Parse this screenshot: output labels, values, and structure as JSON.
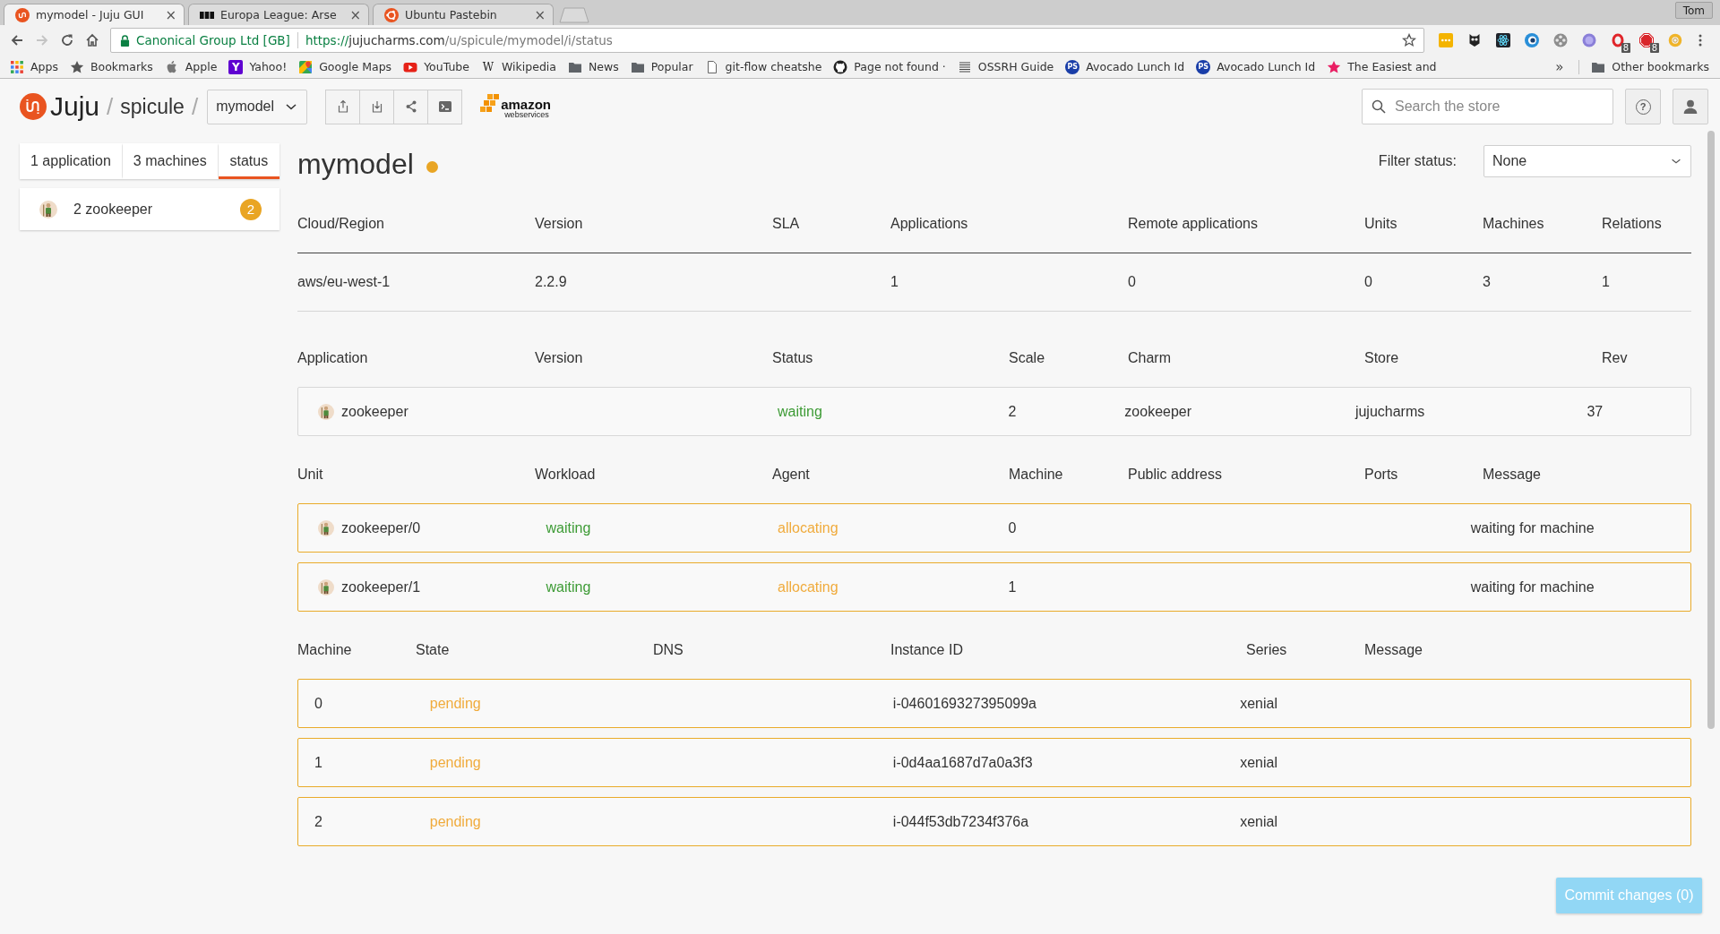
{
  "browser": {
    "tabs": [
      {
        "title": "mymodel - Juju GUI",
        "selected": true,
        "close": "×"
      },
      {
        "title": "Europa League: Arse",
        "selected": false,
        "close": "×"
      },
      {
        "title": "Ubuntu Pastebin",
        "selected": false,
        "close": "×"
      }
    ],
    "profile": "Tom",
    "nav_buttons": [
      {
        "disabled": false
      },
      {
        "disabled": true
      },
      {
        "disabled": false
      },
      {
        "disabled": false
      }
    ],
    "address": {
      "identity": "Canonical Group Ltd [GB]",
      "scheme": "https://",
      "host": "jujucharms.com",
      "path": "/u/spicule/mymodel/i/status"
    },
    "extensions": [
      {
        "kind": "dots"
      },
      {
        "kind": "owl"
      },
      {
        "kind": "atom"
      },
      {
        "kind": "eye"
      },
      {
        "kind": "reel"
      },
      {
        "kind": "ws"
      },
      {
        "kind": "opera",
        "badge": "8"
      },
      {
        "kind": "stop",
        "badge": "8"
      },
      {
        "kind": "donut"
      }
    ],
    "bookmarks": [
      {
        "kind": "apps",
        "label": "Apps"
      },
      {
        "kind": "star",
        "label": "Bookmarks"
      },
      {
        "kind": "apple",
        "label": "Apple"
      },
      {
        "kind": "yahoo",
        "glyph": "Y",
        "label": "Yahoo!"
      },
      {
        "kind": "maps",
        "label": "Google Maps"
      },
      {
        "kind": "play",
        "label": "YouTube"
      },
      {
        "kind": "letter",
        "glyph": "W",
        "label": "Wikipedia"
      },
      {
        "kind": "folder",
        "label": "News"
      },
      {
        "kind": "folder",
        "label": "Popular"
      },
      {
        "kind": "page",
        "label": "git-flow cheatshe"
      },
      {
        "kind": "github",
        "label": "Page not found ·"
      },
      {
        "kind": "list",
        "label": "OSSRH Guide"
      },
      {
        "kind": "ps",
        "glyph": "PS",
        "label": "Avocado Lunch Id"
      },
      {
        "kind": "ps",
        "glyph": "PS",
        "label": "Avocado Lunch Id"
      },
      {
        "kind": "pinkstar",
        "label": "The Easiest and"
      }
    ],
    "overflow": "»",
    "other_bookmarks": "Other bookmarks"
  },
  "app": {
    "header": {
      "logo_text": "Juju",
      "crumbs": [
        {
          "kind": "separator",
          "text": "/"
        },
        {
          "kind": "user",
          "text": "spicule"
        },
        {
          "kind": "separator",
          "text": "/"
        }
      ],
      "model_select": "mymodel",
      "provider": {
        "wordmark": "amazon",
        "tagline": "webservices"
      },
      "search_placeholder": "Search the store",
      "help_glyph": "?"
    },
    "sidebar": {
      "tabs": [
        {
          "label": "1 application",
          "selected": false
        },
        {
          "label": "3 machines",
          "selected": false
        },
        {
          "label": "status",
          "selected": true
        }
      ],
      "items": [
        {
          "label": "2 zookeeper",
          "count": "2"
        }
      ]
    },
    "model": {
      "name": "mymodel",
      "color": "#e9a524"
    },
    "filter": {
      "label": "Filter status:",
      "value": "None"
    },
    "tables": [
      {
        "kind": "summary",
        "columns": [
          "Cloud/Region",
          "Version",
          "SLA",
          "Applications",
          "Remote applications",
          "Units",
          "Machines",
          "Relations"
        ],
        "rows": [
          {
            "cells": [
              "aws/eu-west-1",
              "2.2.9",
              null,
              "1",
              "0",
              "0",
              "3",
              "1"
            ]
          }
        ]
      },
      {
        "kind": "boxed",
        "columns": [
          "Application",
          "Version",
          "Status",
          "Scale",
          "Charm",
          "Store",
          "Rev"
        ],
        "rows": [
          {
            "alert": false,
            "cells": [
              {
                "kind": "charm",
                "text": "zookeeper"
              },
              null,
              {
                "kind": "status",
                "text": "waiting",
                "color": "#3d9b35"
              },
              "2",
              "zookeeper",
              "jujucharms",
              "37"
            ]
          }
        ]
      },
      {
        "kind": "boxed",
        "columns": [
          "Unit",
          "Workload",
          "Agent",
          "Machine",
          "Public address",
          "Ports",
          "Message"
        ],
        "rows": [
          {
            "alert": true,
            "cells": [
              {
                "kind": "charm",
                "text": "zookeeper/0"
              },
              {
                "kind": "status",
                "text": "waiting",
                "color": "#3d9b35"
              },
              {
                "kind": "status",
                "text": "allocating",
                "color": "#f0ab3c"
              },
              "0",
              null,
              null,
              "waiting for machine"
            ]
          },
          {
            "alert": true,
            "cells": [
              {
                "kind": "charm",
                "text": "zookeeper/1"
              },
              {
                "kind": "status",
                "text": "waiting",
                "color": "#3d9b35"
              },
              {
                "kind": "status",
                "text": "allocating",
                "color": "#f0ab3c"
              },
              "1",
              null,
              null,
              "waiting for machine"
            ]
          }
        ]
      },
      {
        "kind": "boxed",
        "columns": [
          "Machine",
          "State",
          "DNS",
          "Instance ID",
          "Series",
          "Message"
        ],
        "rows": [
          {
            "alert": true,
            "cells": [
              "0",
              {
                "kind": "status",
                "text": "pending",
                "color": "#f0ab3c"
              },
              null,
              "i-0460169327395099a",
              "xenial",
              null
            ]
          },
          {
            "alert": true,
            "cells": [
              "1",
              {
                "kind": "status",
                "text": "pending",
                "color": "#f0ab3c"
              },
              null,
              "i-0d4aa1687d7a0a3f3",
              "xenial",
              null
            ]
          },
          {
            "alert": true,
            "cells": [
              "2",
              {
                "kind": "status",
                "text": "pending",
                "color": "#f0ab3c"
              },
              null,
              "i-044f53db7234f376a",
              "xenial",
              null
            ]
          }
        ]
      }
    ],
    "commit_button": {
      "label": "Commit changes (0)",
      "disabled": true
    }
  }
}
